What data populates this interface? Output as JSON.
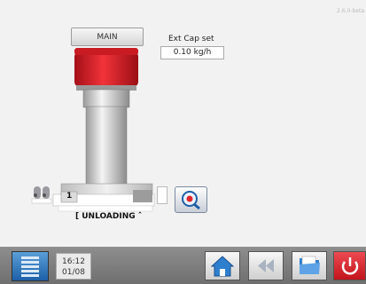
{
  "version": "2.6.0-beta",
  "main_button": {
    "label": "MAIN"
  },
  "ext_cap": {
    "label": "Ext Cap set",
    "value": "0.10 kg/h"
  },
  "station": {
    "number": "1",
    "status": "[ UNLOADING ˆ"
  },
  "bottom_bar": {
    "time": "16:12",
    "date": "01/08"
  },
  "icons": {
    "menu": "list-menu-icon",
    "zoom": "magnify-icon",
    "home": "home-icon",
    "back": "rewind-icon",
    "folder": "folder-icon",
    "power": "power-icon"
  },
  "colors": {
    "hopper_red": "#e01f26",
    "power_red": "#d8202a",
    "menu_blue": "#2f7fcf",
    "bar_grey": "#7d7d7d"
  }
}
